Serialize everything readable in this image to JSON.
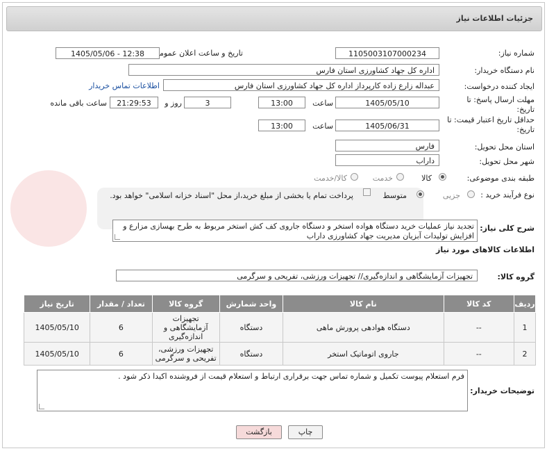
{
  "header": {
    "title": "جزئیات اطلاعات نیاز"
  },
  "fields": {
    "need_number_label": "شماره نیاز:",
    "need_number": "1105003107000234",
    "announce_label": "تاریخ و ساعت اعلان عمومی:",
    "announce_value": "1405/05/06 - 12:38",
    "buyer_org_label": "نام دستگاه خریدار:",
    "buyer_org": "اداره کل جهاد کشاورزی استان فارس",
    "requester_label": "ایجاد کننده درخواست:",
    "requester": "عبداله زارع زاده کارپرداز اداره کل جهاد کشاورزی استان فارس",
    "buyer_contact_link": "اطلاعات تماس خریدار",
    "reply_deadline_label": "مهلت ارسال پاسخ: تا تاریخ:",
    "reply_date": "1405/05/10",
    "time_label": "ساعت",
    "reply_time": "13:00",
    "days_value": "3",
    "days_label": "روز و",
    "remaining_time": "21:29:53",
    "remaining_label": "ساعت باقی مانده",
    "validity_label": "حداقل تاریخ اعتبار قیمت: تا تاریخ:",
    "validity_date": "1405/06/31",
    "validity_time": "13:00",
    "province_label": "استان محل تحویل:",
    "province": "فارس",
    "city_label": "شهر محل تحویل:",
    "city": "داراب",
    "category_label": "طبقه بندی موضوعی:",
    "category_options": [
      "کالا",
      "خدمت",
      "کالا/خدمت"
    ],
    "process_label": "نوع فرآیند خرید :",
    "process_options": [
      "جزیی",
      "متوسط"
    ],
    "payment_note": "پرداخت تمام یا بخشی از مبلغ خرید،از محل \"اسناد خزانه اسلامی\" خواهد بود.",
    "description_label": "شرح کلی نیاز:",
    "description": "تجدید نیاز عملیات خرید دستگاه هواده استخر و دستگاه جاروی کف کش استخر مربوط  به طرح بهسازی مزارع و افزایش تولیدات آبزیان مدیریت جهاد کشاورزی داراب",
    "goods_info_title": "اطلاعات کالاهای مورد نیاز",
    "goods_group_label": "گروه کالا:",
    "goods_group": "تجهیزات آزمایشگاهی و اندازه‌گیری// تجهیزات ورزشی، تفریحی و سرگرمی",
    "buyer_notes_label": "توضیحات خریدار:",
    "buyer_notes": "فرم استعلام پیوست تکمیل و شماره تماس جهت برقراری ارتباط و استعلام قیمت از فروشنده اکیدا ذکر شود ."
  },
  "table": {
    "headers": [
      "ردیف",
      "کد کالا",
      "نام کالا",
      "واحد شمارش",
      "گروه کالا",
      "تعداد / مقدار",
      "تاریخ نیاز"
    ],
    "rows": [
      [
        "1",
        "--",
        "دستگاه هوادهی پرورش ماهی",
        "دستگاه",
        "تجهیزات آزمایشگاهی و اندازه‌گیری",
        "6",
        "1405/05/10"
      ],
      [
        "2",
        "--",
        "جاروی اتوماتیک استخر",
        "دستگاه",
        "تجهیزات ورزشی، تفریحی و سرگرمی",
        "6",
        "1405/05/10"
      ]
    ]
  },
  "buttons": {
    "print": "چاپ",
    "back": "بازگشت"
  },
  "colors": {
    "table_header": "#8c8c8c",
    "back_button": "#f6dada",
    "link": "#1a4fa0"
  }
}
